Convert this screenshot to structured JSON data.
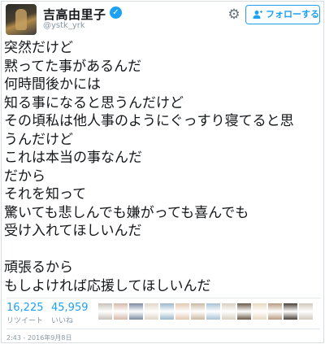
{
  "header": {
    "name": "吉高由里子",
    "handle": "@ystk_yrk",
    "follow_label": "フォローする"
  },
  "icons": [
    "verified-badge-icon",
    "gear-icon",
    "follow-person-icon"
  ],
  "tweet": {
    "lines": [
      "突然だけど",
      "黙ってた事があるんだ",
      "何時間後かには",
      "知る事になると思うんだけど",
      "その頃私は他人事のようにぐっすり寝てると思",
      "うんだけど",
      "これは本当の事なんだ",
      "だから",
      "それを知って",
      "驚いても悲しんでも嫌がっても喜んでも",
      "受け入れてほしいんだ",
      "",
      "頑張るから",
      "もしよければ応援してほしいんだ"
    ]
  },
  "stats": {
    "retweets": "16,225",
    "retweets_label": "リツイート",
    "likes": "45,959",
    "likes_label": "いいね"
  },
  "liker_avatar_colors": [
    "#c7c2b8",
    "#d6b7a8",
    "#7a8aa0",
    "#e0d6c8",
    "#9bb7c9",
    "#e3c7b0",
    "#cbb8a0",
    "#a8c2d6",
    "#d8cfc0",
    "#6a5a48",
    "#e8d8c0",
    "#b89a80",
    "#4a4038",
    "#d0c8bc"
  ],
  "timestamp": "2:43 - 2016年9月8日",
  "colors": {
    "accent": "#1da1f2",
    "text": "#14171a",
    "muted": "#8899a6"
  }
}
